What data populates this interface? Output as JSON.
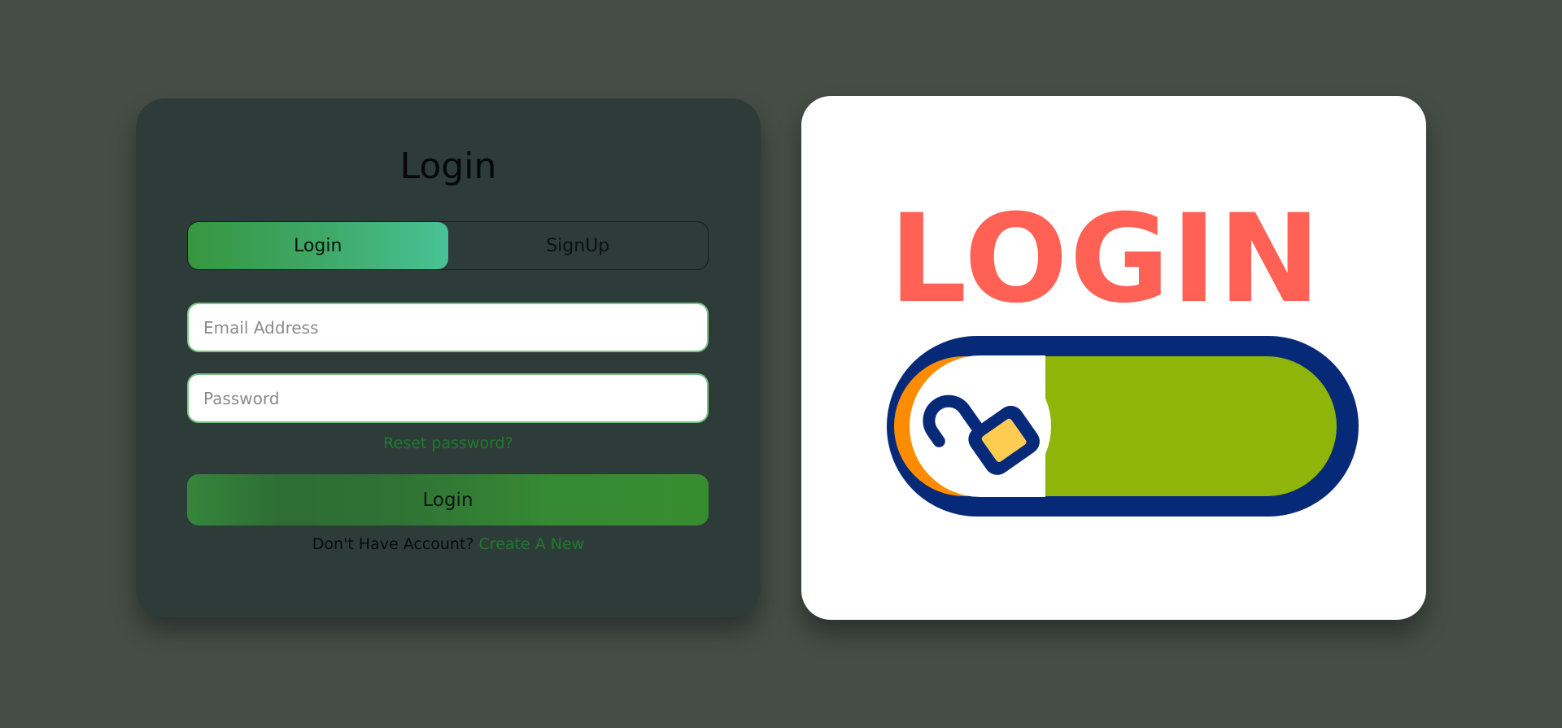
{
  "form": {
    "title": "Login",
    "tabs": [
      {
        "label": "Login",
        "active": true
      },
      {
        "label": "SignUp",
        "active": false
      }
    ],
    "email_placeholder": "Email Address",
    "password_placeholder": "Password",
    "reset_link": "Reset password?",
    "submit_label": "Login",
    "signup_prompt": "Don't Have Account?",
    "signup_link": "Create A New"
  },
  "illustration": {
    "word": "LOGIN",
    "icon": "unlocked-padlock-toggle-icon",
    "colors": {
      "word": "#ff6154",
      "toggle_outline": "#062a78",
      "toggle_fill": "#90b50a",
      "knob_shadow": "#ff8c00",
      "lock_body": "#ffcc52"
    }
  },
  "theme": {
    "background": "#454d46",
    "card": "#2d3c39",
    "accent": "#37963f",
    "link": "#1f7a2d"
  }
}
